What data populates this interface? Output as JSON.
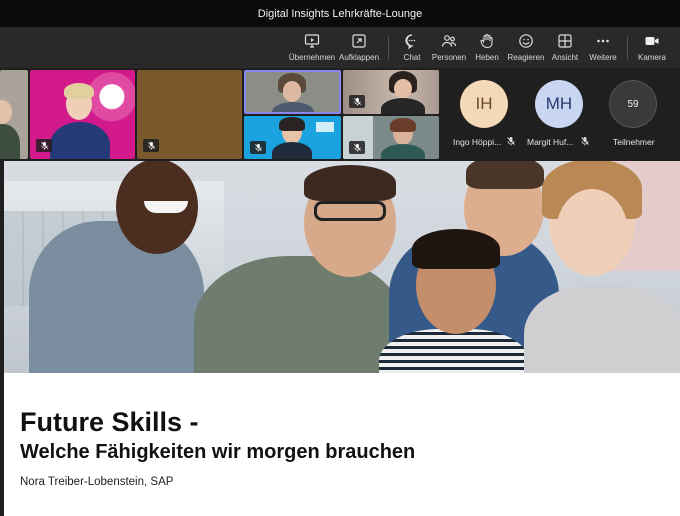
{
  "window": {
    "title": "Digital Insights Lehrkräfte-Lounge"
  },
  "toolbar": {
    "items": [
      {
        "label": "Übernehmen",
        "icon": "take-control-icon"
      },
      {
        "label": "Aufklappen",
        "icon": "expand-icon"
      },
      {
        "label": "Chat",
        "icon": "chat-icon"
      },
      {
        "label": "Personen",
        "icon": "people-icon"
      },
      {
        "label": "Heben",
        "icon": "raise-hand-icon"
      },
      {
        "label": "Reagieren",
        "icon": "react-icon"
      },
      {
        "label": "Ansicht",
        "icon": "view-icon"
      },
      {
        "label": "Weitere",
        "icon": "more-icon"
      },
      {
        "label": "Kamera",
        "icon": "camera-icon"
      }
    ]
  },
  "participants": {
    "avatars": [
      {
        "initials": "IH",
        "name": "Ingo Höppi...",
        "color": "#f3d9b8",
        "text_color": "#6e4a25"
      },
      {
        "initials": "MH",
        "name": "Margit Huf...",
        "color": "#c9d6f2",
        "text_color": "#233a6e"
      }
    ],
    "count": "59",
    "count_label": "Teilnehmer"
  },
  "slide": {
    "title": "Future Skills -",
    "subtitle": "Welche Fähigkeiten wir morgen brauchen",
    "author": "Nora Treiber-Lobenstein, SAP"
  },
  "colors": {
    "toolbar_bg": "#292929",
    "titlebar_bg": "#0b0b0b",
    "active_speaker_border": "#8a86f0",
    "tile_magenta": "#d31a8c",
    "tile_brown": "#7a5a2c",
    "tile_blue": "#1ba3e0"
  }
}
